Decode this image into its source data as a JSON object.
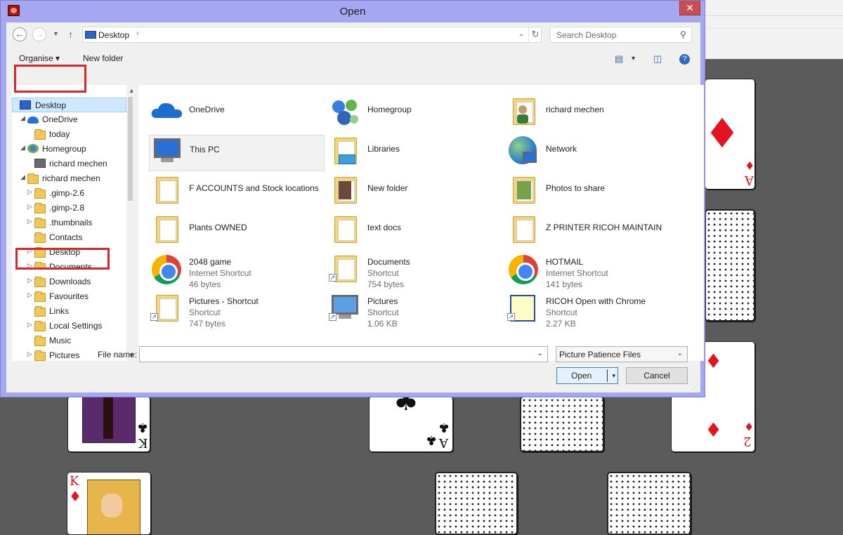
{
  "dialog": {
    "title": "Open",
    "close_glyph": "✕",
    "app_icon": "cards-app-icon"
  },
  "address": {
    "back_glyph": "←",
    "forward_glyph": "→",
    "recent_glyph": "▾",
    "up_glyph": "↑",
    "location": "Desktop",
    "sep_glyph": "›",
    "dropdown_glyph": "⌄",
    "refresh_glyph": "↻"
  },
  "search": {
    "placeholder": "Search Desktop",
    "icon_glyph": "⚲"
  },
  "toolbar": {
    "organise": "Organise ▾",
    "new_folder": "New folder",
    "view_glyph": "▤",
    "view_dd_glyph": "▾",
    "pane_glyph": "◫",
    "help_glyph": "?"
  },
  "nav": {
    "items": [
      {
        "label": "Desktop",
        "icon": "desktop-icon",
        "expander": "",
        "selected": true
      },
      {
        "label": "OneDrive",
        "icon": "onedrive-icon",
        "expander": "◢"
      },
      {
        "label": "today",
        "icon": "folder-icon",
        "expander": ""
      },
      {
        "label": "Homegroup",
        "icon": "homegroup-icon",
        "expander": "◢"
      },
      {
        "label": "richard mechen",
        "icon": "user-icon",
        "expander": ""
      },
      {
        "label": "richard mechen",
        "icon": "user-folder-icon",
        "expander": "◢"
      },
      {
        "label": ".gimp-2.6",
        "icon": "folder-icon",
        "expander": "▷"
      },
      {
        "label": ".gimp-2.8",
        "icon": "folder-icon",
        "expander": "▷"
      },
      {
        "label": ".thumbnails",
        "icon": "folder-icon",
        "expander": "▷"
      },
      {
        "label": "Contacts",
        "icon": "contacts-icon",
        "expander": ""
      },
      {
        "label": "Desktop",
        "icon": "folder-icon",
        "expander": "▷"
      },
      {
        "label": "Documents",
        "icon": "folder-icon",
        "expander": "▷"
      },
      {
        "label": "Downloads",
        "icon": "downloads-icon",
        "expander": "▷"
      },
      {
        "label": "Favourites",
        "icon": "favourites-icon",
        "expander": "▷"
      },
      {
        "label": "Links",
        "icon": "links-icon",
        "expander": ""
      },
      {
        "label": "Local Settings",
        "icon": "folder-icon",
        "expander": "▷"
      },
      {
        "label": "Music",
        "icon": "music-icon",
        "expander": ""
      },
      {
        "label": "Pictures",
        "icon": "pictures-icon",
        "expander": "▷"
      }
    ],
    "scroll_up": "▲",
    "scroll_down": "▼"
  },
  "files": [
    {
      "name": "OneDrive",
      "icon": "onedrive-icon"
    },
    {
      "name": "Homegroup",
      "icon": "homegroup-icon"
    },
    {
      "name": "richard mechen",
      "icon": "user-folder-icon"
    },
    {
      "name": "This PC",
      "icon": "computer-icon",
      "selected": true
    },
    {
      "name": "Libraries",
      "icon": "libraries-icon"
    },
    {
      "name": "Network",
      "icon": "network-icon"
    },
    {
      "name": "F ACCOUNTS and Stock locations",
      "icon": "folder-icon"
    },
    {
      "name": "New folder",
      "icon": "folder-icon"
    },
    {
      "name": "Photos to share",
      "icon": "folder-icon"
    },
    {
      "name": "Plants OWNED",
      "icon": "folder-icon"
    },
    {
      "name": "text docs",
      "icon": "folder-icon"
    },
    {
      "name": "Z PRINTER RICOH MAINTAIN",
      "icon": "folder-icon"
    },
    {
      "name": "2048 game",
      "type": "Internet Shortcut",
      "size": "46 bytes",
      "icon": "chrome-icon"
    },
    {
      "name": "Documents",
      "type": "Shortcut",
      "size": "754 bytes",
      "icon": "folder-shortcut-icon"
    },
    {
      "name": "HOTMAIL",
      "type": "Internet Shortcut",
      "size": "141 bytes",
      "icon": "chrome-icon"
    },
    {
      "name": "Pictures - Shortcut",
      "type": "Shortcut",
      "size": "747 bytes",
      "icon": "folder-shortcut-icon"
    },
    {
      "name": "Pictures",
      "type": "Shortcut",
      "size": "1.06 KB",
      "icon": "computer-shortcut-icon"
    },
    {
      "name": "RICOH Open with Chrome",
      "type": "Shortcut",
      "size": "2.27 KB",
      "icon": "web-shortcut-icon"
    }
  ],
  "bottom": {
    "file_name_label": "File name:",
    "file_name_value": "",
    "file_type": "Picture Patience Files",
    "open": "Open",
    "cancel": "Cancel",
    "dropdown_glyph": "⌄",
    "split_glyph": "▾",
    "grip_glyph": "⋰"
  },
  "cards": {
    "top_right": {
      "rank": "A",
      "suit": "♦"
    },
    "middle_right": {
      "rank": "2",
      "suit": "♦"
    },
    "bottom_center": {
      "rank": "A",
      "suit": "♣"
    },
    "bottom_left": {
      "rank": "K",
      "suit": "♣"
    },
    "bottom_left2": {
      "rank": "K",
      "suit": "♦"
    }
  },
  "colors": {
    "dialog_frame": "#a5a8f0",
    "annotation": "#d62a2a",
    "selection": "#cde8ff",
    "table_background": "#5b5b5b"
  }
}
